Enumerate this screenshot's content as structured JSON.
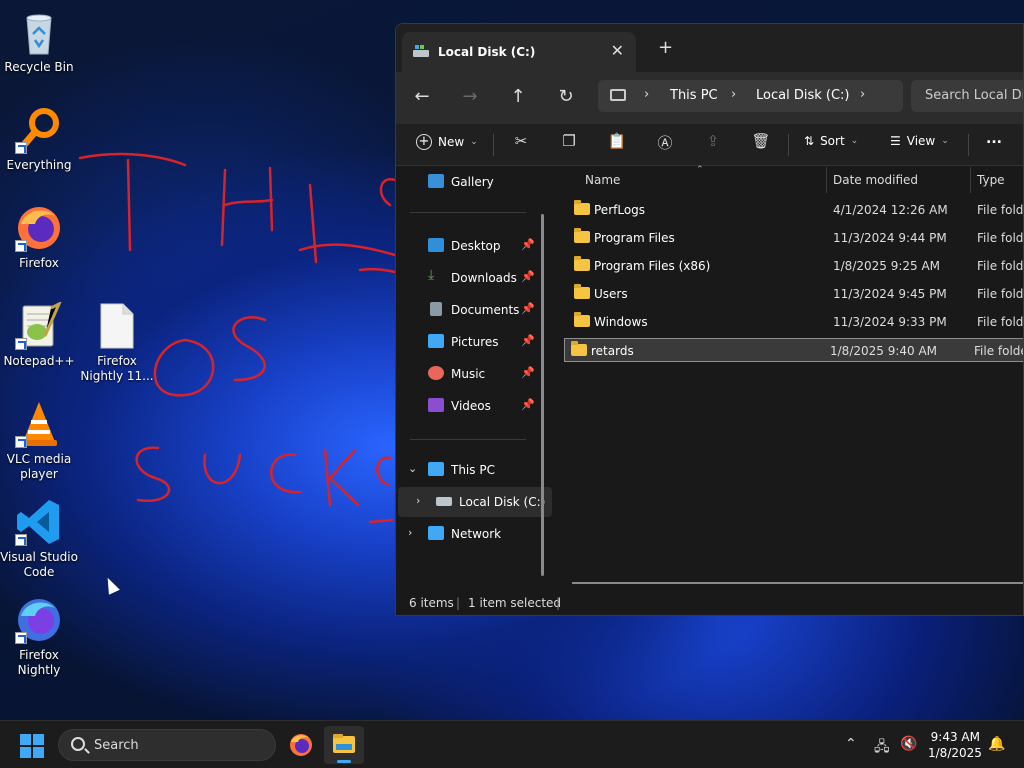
{
  "desktop": {
    "icons": [
      {
        "label": "Recycle Bin",
        "icon": "recycle-bin-icon"
      },
      {
        "label": "Everything",
        "icon": "everything-search-icon"
      },
      {
        "label": "Firefox",
        "icon": "firefox-icon"
      },
      {
        "label": "Notepad++",
        "icon": "notepad-plus-plus-icon"
      },
      {
        "label": "Firefox Nightly 11...",
        "icon": "file-icon"
      },
      {
        "label": "VLC media player",
        "icon": "vlc-icon"
      },
      {
        "label": "Visual Studio Code",
        "icon": "vscode-icon"
      },
      {
        "label": "Firefox Nightly",
        "icon": "firefox-nightly-icon"
      }
    ],
    "scribble_text": "THIS OS SUCKS"
  },
  "explorer": {
    "tab_title": "Local Disk (C:)",
    "new_tab": "+",
    "breadcrumbs": [
      "This PC",
      "Local Disk (C:)"
    ],
    "search_placeholder": "Search Local Disk",
    "toolbar": {
      "new_label": "New",
      "sort_label": "Sort",
      "view_label": "View",
      "more_label": "..."
    },
    "nav": {
      "gallery": "Gallery",
      "desktop": "Desktop",
      "downloads": "Downloads",
      "documents": "Documents",
      "pictures": "Pictures",
      "music": "Music",
      "videos": "Videos",
      "this_pc": "This PC",
      "local_disk": "Local Disk (C:)",
      "network": "Network"
    },
    "columns": {
      "name": "Name",
      "date": "Date modified",
      "type": "Type"
    },
    "rows": [
      {
        "name": "PerfLogs",
        "date": "4/1/2024 12:26 AM",
        "type": "File folder"
      },
      {
        "name": "Program Files",
        "date": "11/3/2024 9:44 PM",
        "type": "File folder"
      },
      {
        "name": "Program Files (x86)",
        "date": "1/8/2025 9:25 AM",
        "type": "File folder"
      },
      {
        "name": "Users",
        "date": "11/3/2024 9:45 PM",
        "type": "File folder"
      },
      {
        "name": "Windows",
        "date": "11/3/2024 9:33 PM",
        "type": "File folder"
      },
      {
        "name": "retards",
        "date": "1/8/2025 9:40 AM",
        "type": "File folder"
      }
    ],
    "status": {
      "items": "6 items",
      "selected": "1 item selected"
    }
  },
  "taskbar": {
    "search_label": "Search",
    "time": "9:43 AM",
    "date": "1/8/2025"
  },
  "colors": {
    "accent": "#3fa9f5",
    "folder": "#f6c443",
    "scribble": "#d8232a"
  }
}
